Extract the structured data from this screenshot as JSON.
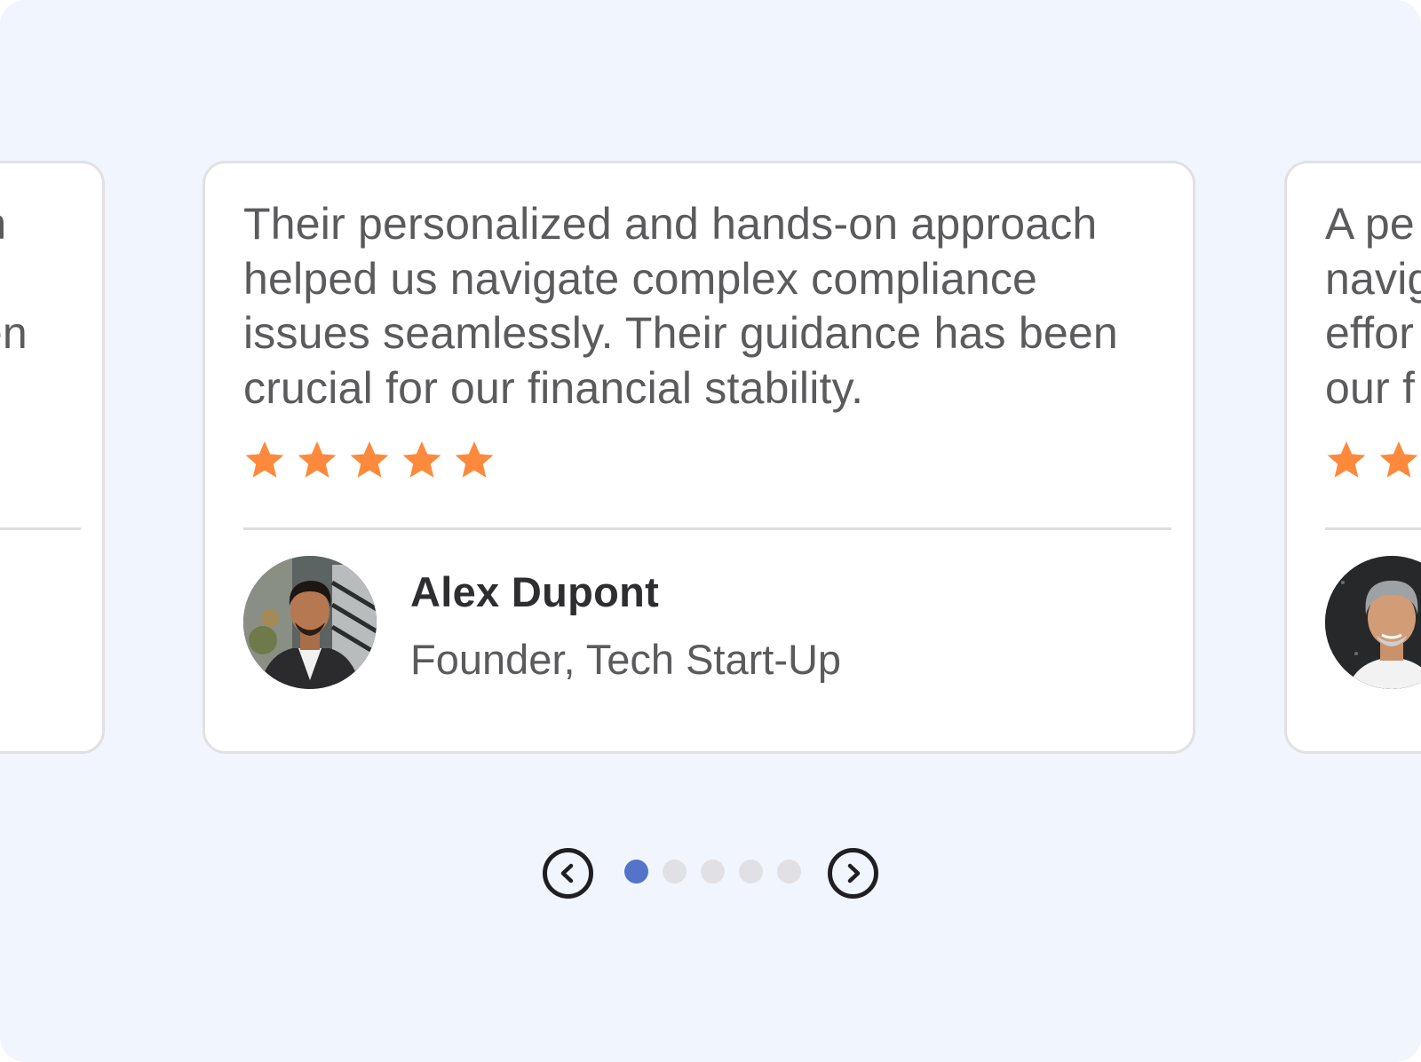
{
  "colors": {
    "background": "#f0f5fe",
    "card": "#ffffff",
    "star": "#fd8a3c",
    "active_dot": "#5474c9",
    "inactive_dot": "#e1e1e5"
  },
  "testimonials": [
    {
      "quote": "Their personalized and hands-on approach helped us navigate complex compliance issues seamlessly. Their guidance has been crucial for our financial stability.",
      "rating": 5,
      "name": "",
      "role": "",
      "avatar": "man-avatar"
    },
    {
      "quote": "Their personalized and hands-on approach helped us navigate complex compliance issues seamlessly. Their guidance has been crucial for our financial stability.",
      "rating": 5,
      "name": "Alex Dupont",
      "role": "Founder, Tech Start-Up",
      "avatar": "young-man-avatar"
    },
    {
      "quote": "A pe navig effor our f",
      "rating": 5,
      "name": "",
      "role": "",
      "avatar": "gray-haired-man-avatar"
    }
  ],
  "pagination": {
    "prev_icon": "chevron-left-icon",
    "next_icon": "chevron-right-icon",
    "total_pages": 5,
    "active_page": 1
  }
}
